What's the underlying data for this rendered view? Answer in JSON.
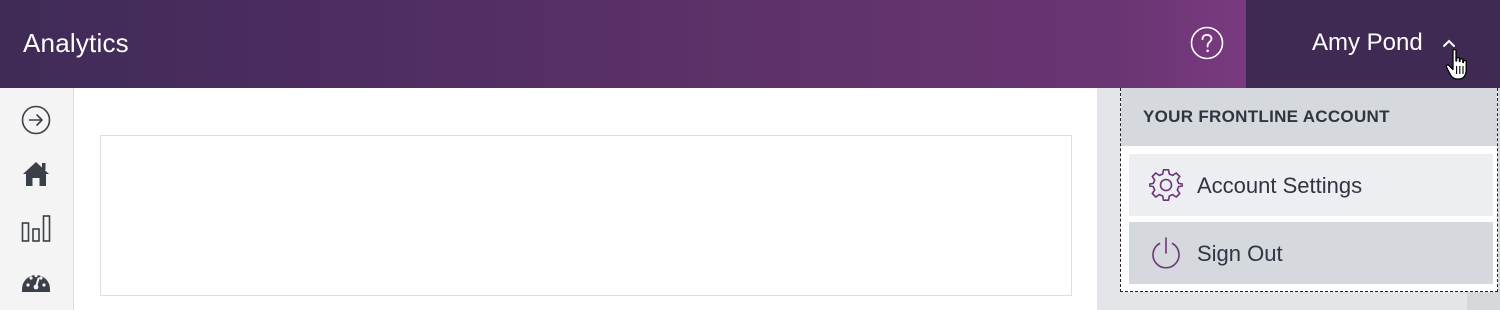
{
  "header": {
    "app_title": "Analytics",
    "help_icon": "question-circle-icon",
    "user_name": "Amy Pond",
    "chevron_icon": "chevron-up-icon"
  },
  "sidebar": {
    "items": [
      {
        "icon": "arrow-right-circle-icon"
      },
      {
        "icon": "home-icon"
      },
      {
        "icon": "bar-chart-icon"
      },
      {
        "icon": "dashboard-gauge-icon"
      }
    ]
  },
  "user_menu": {
    "section_title": "YOUR FRONTLINE ACCOUNT",
    "items": [
      {
        "label": "Account Settings",
        "icon": "gear-icon"
      },
      {
        "label": "Sign Out",
        "icon": "power-icon"
      }
    ]
  },
  "colors": {
    "header_start": "#3f2b56",
    "header_end": "#7a3a80",
    "accent_purple": "#6d3577",
    "user_area": "#3f2a53"
  }
}
